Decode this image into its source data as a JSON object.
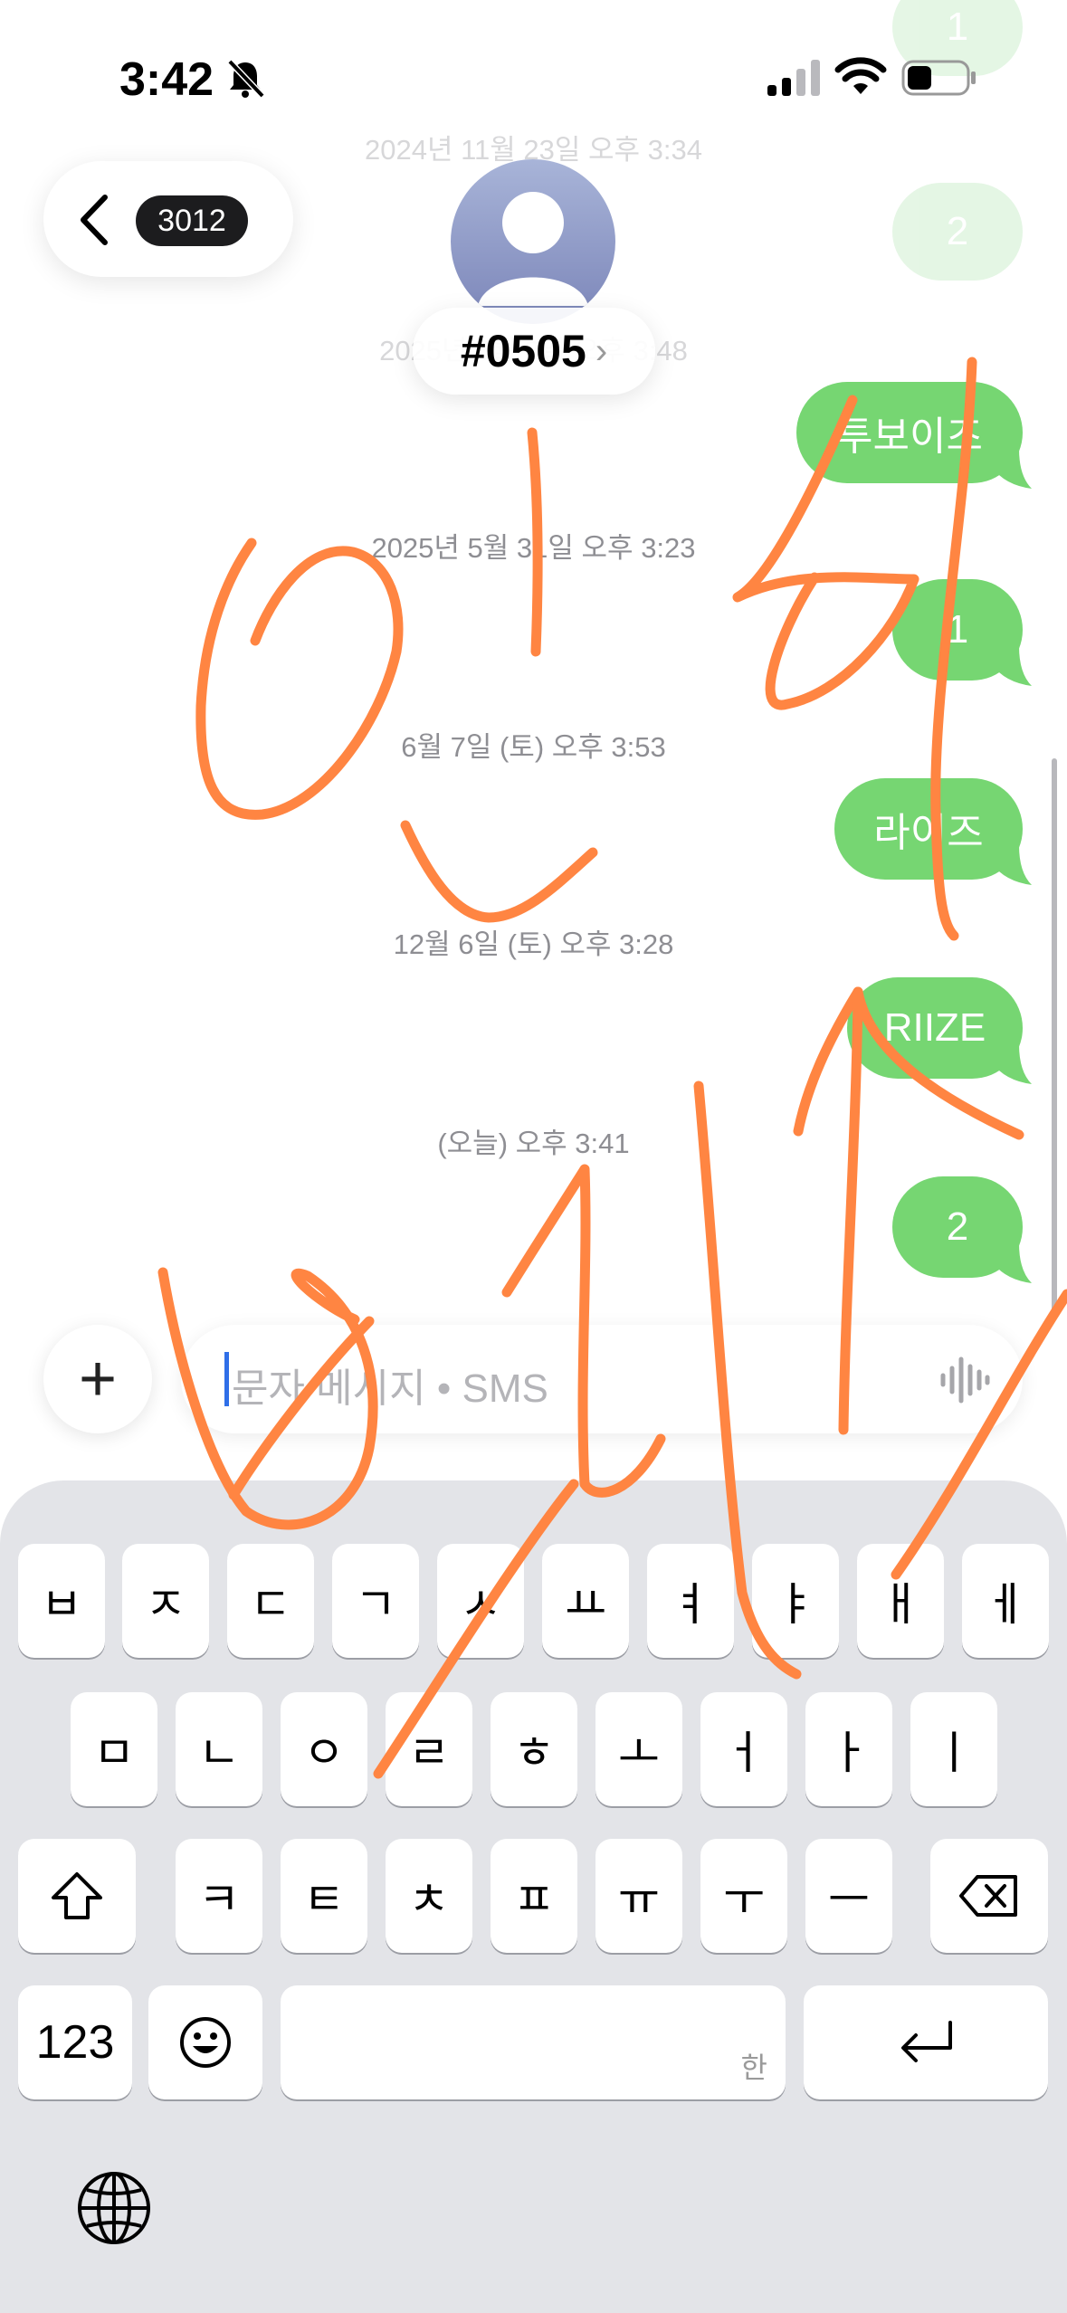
{
  "status_bar": {
    "time": "3:42"
  },
  "header": {
    "unread_count": "3012",
    "contact_name": "#0505",
    "chevron": "›"
  },
  "timestamps": [
    "2024년 11월 23일 오후 3:34",
    "2025년 5월 3일 오후 3:48",
    "2025년 5월 31일 오후 3:23",
    "6월 7일 (토) 오후 3:53",
    "12월 6일 (토) 오후 3:28",
    "(오늘) 오후 3:41"
  ],
  "messages": [
    "1",
    "2",
    "투보이즈",
    "1",
    "라이즈",
    "RIIZE",
    "2"
  ],
  "composer": {
    "add": "+",
    "placeholder": "문자 메시지 • SMS"
  },
  "keyboard": {
    "row1": [
      "ㅂ",
      "ㅈ",
      "ㄷ",
      "ㄱ",
      "ㅅ",
      "ㅛ",
      "ㅕ",
      "ㅑ",
      "ㅐ",
      "ㅔ"
    ],
    "row2": [
      "ㅁ",
      "ㄴ",
      "ㅇ",
      "ㄹ",
      "ㅎ",
      "ㅗ",
      "ㅓ",
      "ㅏ",
      "ㅣ"
    ],
    "row3": [
      "ㅋ",
      "ㅌ",
      "ㅊ",
      "ㅍ",
      "ㅠ",
      "ㅜ",
      "ㅡ"
    ],
    "numbers_key": "123",
    "emoji_key": "☺",
    "space_hint": "한",
    "shift_icon": "shift-arrow-icon",
    "delete_icon": "delete-backward-icon",
    "return_icon": "return-arrow-icon",
    "globe_icon": "globe-icon"
  },
  "colors": {
    "bubble": "#76d672",
    "scribble": "#ff8542",
    "keyboard_bg": "#e3e4e8"
  }
}
